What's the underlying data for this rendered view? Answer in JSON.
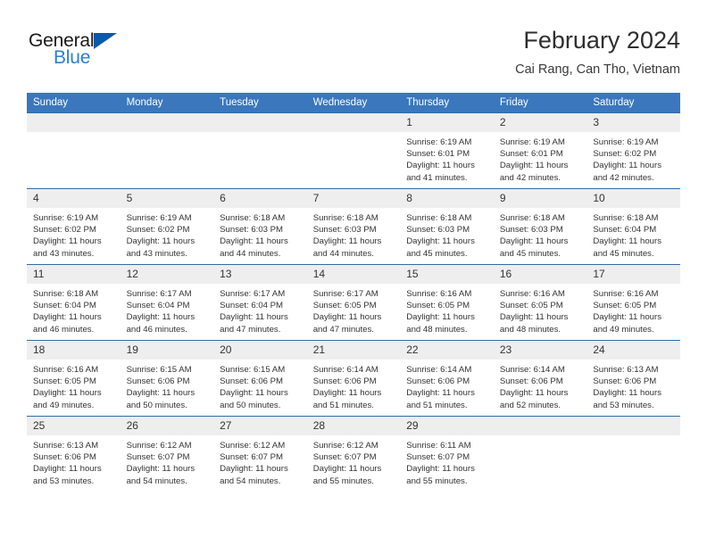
{
  "brand": {
    "word_one": "General",
    "word_two": "Blue",
    "triangle_icon": "brand-triangle-icon",
    "blue_hex": "#2b7fd4",
    "triangle_hex": "#0a5aa8"
  },
  "header": {
    "title": "February 2024",
    "subtitle": "Cai Rang, Can Tho, Vietnam"
  },
  "theme": {
    "header_bg": "#3a77bd",
    "header_text": "#ffffff",
    "row_border": "#2e6da8",
    "daynum_bg": "#eeeeee",
    "body_text": "#333333"
  },
  "calendar": {
    "weekday_headers": [
      "Sunday",
      "Monday",
      "Tuesday",
      "Wednesday",
      "Thursday",
      "Friday",
      "Saturday"
    ],
    "weeks": [
      [
        {
          "day": "",
          "sunrise": "",
          "sunset": "",
          "daylight_line1": "",
          "daylight_line2": ""
        },
        {
          "day": "",
          "sunrise": "",
          "sunset": "",
          "daylight_line1": "",
          "daylight_line2": ""
        },
        {
          "day": "",
          "sunrise": "",
          "sunset": "",
          "daylight_line1": "",
          "daylight_line2": ""
        },
        {
          "day": "",
          "sunrise": "",
          "sunset": "",
          "daylight_line1": "",
          "daylight_line2": ""
        },
        {
          "day": "1",
          "sunrise": "Sunrise: 6:19 AM",
          "sunset": "Sunset: 6:01 PM",
          "daylight_line1": "Daylight: 11 hours",
          "daylight_line2": "and 41 minutes."
        },
        {
          "day": "2",
          "sunrise": "Sunrise: 6:19 AM",
          "sunset": "Sunset: 6:01 PM",
          "daylight_line1": "Daylight: 11 hours",
          "daylight_line2": "and 42 minutes."
        },
        {
          "day": "3",
          "sunrise": "Sunrise: 6:19 AM",
          "sunset": "Sunset: 6:02 PM",
          "daylight_line1": "Daylight: 11 hours",
          "daylight_line2": "and 42 minutes."
        }
      ],
      [
        {
          "day": "4",
          "sunrise": "Sunrise: 6:19 AM",
          "sunset": "Sunset: 6:02 PM",
          "daylight_line1": "Daylight: 11 hours",
          "daylight_line2": "and 43 minutes."
        },
        {
          "day": "5",
          "sunrise": "Sunrise: 6:19 AM",
          "sunset": "Sunset: 6:02 PM",
          "daylight_line1": "Daylight: 11 hours",
          "daylight_line2": "and 43 minutes."
        },
        {
          "day": "6",
          "sunrise": "Sunrise: 6:18 AM",
          "sunset": "Sunset: 6:03 PM",
          "daylight_line1": "Daylight: 11 hours",
          "daylight_line2": "and 44 minutes."
        },
        {
          "day": "7",
          "sunrise": "Sunrise: 6:18 AM",
          "sunset": "Sunset: 6:03 PM",
          "daylight_line1": "Daylight: 11 hours",
          "daylight_line2": "and 44 minutes."
        },
        {
          "day": "8",
          "sunrise": "Sunrise: 6:18 AM",
          "sunset": "Sunset: 6:03 PM",
          "daylight_line1": "Daylight: 11 hours",
          "daylight_line2": "and 45 minutes."
        },
        {
          "day": "9",
          "sunrise": "Sunrise: 6:18 AM",
          "sunset": "Sunset: 6:03 PM",
          "daylight_line1": "Daylight: 11 hours",
          "daylight_line2": "and 45 minutes."
        },
        {
          "day": "10",
          "sunrise": "Sunrise: 6:18 AM",
          "sunset": "Sunset: 6:04 PM",
          "daylight_line1": "Daylight: 11 hours",
          "daylight_line2": "and 45 minutes."
        }
      ],
      [
        {
          "day": "11",
          "sunrise": "Sunrise: 6:18 AM",
          "sunset": "Sunset: 6:04 PM",
          "daylight_line1": "Daylight: 11 hours",
          "daylight_line2": "and 46 minutes."
        },
        {
          "day": "12",
          "sunrise": "Sunrise: 6:17 AM",
          "sunset": "Sunset: 6:04 PM",
          "daylight_line1": "Daylight: 11 hours",
          "daylight_line2": "and 46 minutes."
        },
        {
          "day": "13",
          "sunrise": "Sunrise: 6:17 AM",
          "sunset": "Sunset: 6:04 PM",
          "daylight_line1": "Daylight: 11 hours",
          "daylight_line2": "and 47 minutes."
        },
        {
          "day": "14",
          "sunrise": "Sunrise: 6:17 AM",
          "sunset": "Sunset: 6:05 PM",
          "daylight_line1": "Daylight: 11 hours",
          "daylight_line2": "and 47 minutes."
        },
        {
          "day": "15",
          "sunrise": "Sunrise: 6:16 AM",
          "sunset": "Sunset: 6:05 PM",
          "daylight_line1": "Daylight: 11 hours",
          "daylight_line2": "and 48 minutes."
        },
        {
          "day": "16",
          "sunrise": "Sunrise: 6:16 AM",
          "sunset": "Sunset: 6:05 PM",
          "daylight_line1": "Daylight: 11 hours",
          "daylight_line2": "and 48 minutes."
        },
        {
          "day": "17",
          "sunrise": "Sunrise: 6:16 AM",
          "sunset": "Sunset: 6:05 PM",
          "daylight_line1": "Daylight: 11 hours",
          "daylight_line2": "and 49 minutes."
        }
      ],
      [
        {
          "day": "18",
          "sunrise": "Sunrise: 6:16 AM",
          "sunset": "Sunset: 6:05 PM",
          "daylight_line1": "Daylight: 11 hours",
          "daylight_line2": "and 49 minutes."
        },
        {
          "day": "19",
          "sunrise": "Sunrise: 6:15 AM",
          "sunset": "Sunset: 6:06 PM",
          "daylight_line1": "Daylight: 11 hours",
          "daylight_line2": "and 50 minutes."
        },
        {
          "day": "20",
          "sunrise": "Sunrise: 6:15 AM",
          "sunset": "Sunset: 6:06 PM",
          "daylight_line1": "Daylight: 11 hours",
          "daylight_line2": "and 50 minutes."
        },
        {
          "day": "21",
          "sunrise": "Sunrise: 6:14 AM",
          "sunset": "Sunset: 6:06 PM",
          "daylight_line1": "Daylight: 11 hours",
          "daylight_line2": "and 51 minutes."
        },
        {
          "day": "22",
          "sunrise": "Sunrise: 6:14 AM",
          "sunset": "Sunset: 6:06 PM",
          "daylight_line1": "Daylight: 11 hours",
          "daylight_line2": "and 51 minutes."
        },
        {
          "day": "23",
          "sunrise": "Sunrise: 6:14 AM",
          "sunset": "Sunset: 6:06 PM",
          "daylight_line1": "Daylight: 11 hours",
          "daylight_line2": "and 52 minutes."
        },
        {
          "day": "24",
          "sunrise": "Sunrise: 6:13 AM",
          "sunset": "Sunset: 6:06 PM",
          "daylight_line1": "Daylight: 11 hours",
          "daylight_line2": "and 53 minutes."
        }
      ],
      [
        {
          "day": "25",
          "sunrise": "Sunrise: 6:13 AM",
          "sunset": "Sunset: 6:06 PM",
          "daylight_line1": "Daylight: 11 hours",
          "daylight_line2": "and 53 minutes."
        },
        {
          "day": "26",
          "sunrise": "Sunrise: 6:12 AM",
          "sunset": "Sunset: 6:07 PM",
          "daylight_line1": "Daylight: 11 hours",
          "daylight_line2": "and 54 minutes."
        },
        {
          "day": "27",
          "sunrise": "Sunrise: 6:12 AM",
          "sunset": "Sunset: 6:07 PM",
          "daylight_line1": "Daylight: 11 hours",
          "daylight_line2": "and 54 minutes."
        },
        {
          "day": "28",
          "sunrise": "Sunrise: 6:12 AM",
          "sunset": "Sunset: 6:07 PM",
          "daylight_line1": "Daylight: 11 hours",
          "daylight_line2": "and 55 minutes."
        },
        {
          "day": "29",
          "sunrise": "Sunrise: 6:11 AM",
          "sunset": "Sunset: 6:07 PM",
          "daylight_line1": "Daylight: 11 hours",
          "daylight_line2": "and 55 minutes."
        },
        {
          "day": "",
          "sunrise": "",
          "sunset": "",
          "daylight_line1": "",
          "daylight_line2": ""
        },
        {
          "day": "",
          "sunrise": "",
          "sunset": "",
          "daylight_line1": "",
          "daylight_line2": ""
        }
      ]
    ]
  }
}
